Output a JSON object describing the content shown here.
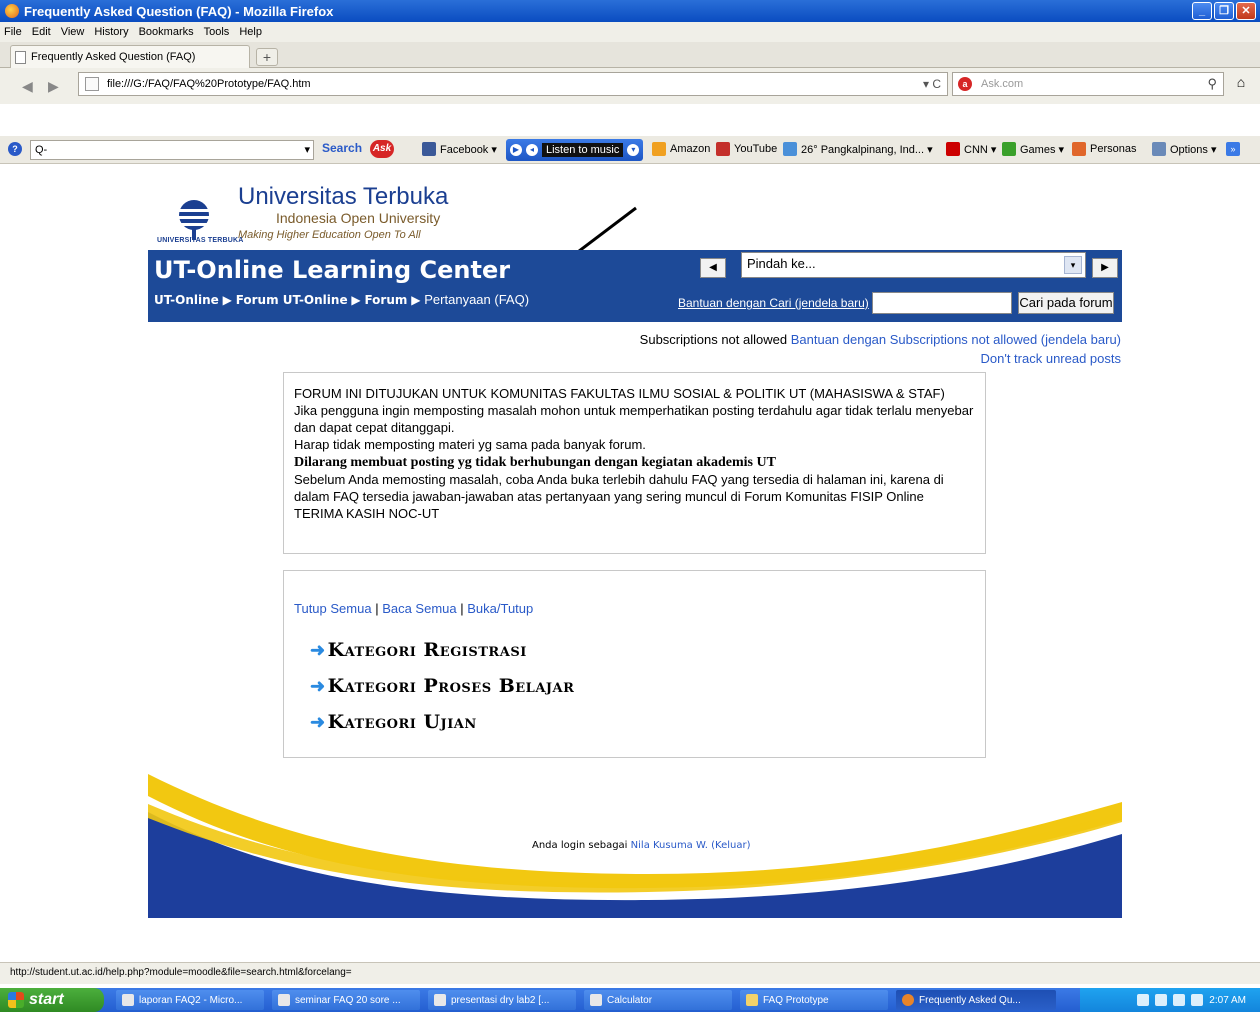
{
  "window": {
    "title": "Frequently Asked Question (FAQ) - Mozilla Firefox",
    "buttons": [
      "_",
      "❐",
      "✕"
    ]
  },
  "menu": [
    "File",
    "Edit",
    "View",
    "History",
    "Bookmarks",
    "Tools",
    "Help"
  ],
  "tab": {
    "label": "Frequently Asked Question (FAQ)",
    "new_tab": "+"
  },
  "nav": {
    "url": "file:///G:/FAQ/FAQ%20Prototype/FAQ.htm",
    "ask_placeholder": "Ask.com"
  },
  "toolbar": {
    "search_placeholder": "Q-",
    "search_label": "Search",
    "ask_logo": "Ask",
    "items": [
      {
        "label": "Facebook ▾",
        "color": "#3b5998"
      },
      {
        "label": "Amazon",
        "color": "#f0a020"
      },
      {
        "label": "YouTube",
        "color": "#c4302b"
      },
      {
        "label": "26° Pangkalpinang, Ind... ▾",
        "color": "#4a90d9"
      },
      {
        "label": "CNN ▾",
        "color": "#cc0000"
      },
      {
        "label": "Games ▾",
        "color": "#3aa02a"
      },
      {
        "label": "Personas",
        "color": "#e0662a"
      },
      {
        "label": "Options ▾",
        "color": "#6a8ab8"
      }
    ],
    "music_label": "Listen to music"
  },
  "site": {
    "uni_name": "Universitas Terbuka",
    "uni_sub": "Indonesia Open University",
    "uni_tag": "Making Higher Education Open To All",
    "logo_caption": "UNIVERSITAS TERBUKA",
    "title": "UT-Online Learning Center",
    "breadcrumb": {
      "b1": "UT-Online",
      "b2": "Forum UT-Online",
      "b3": "Forum",
      "current": "Pertanyaan (FAQ)"
    },
    "jump_placeholder": "Pindah ke...",
    "help_search_link": "Bantuan dengan Cari (jendela baru)",
    "search_button": "Cari pada forum"
  },
  "subscriptions": {
    "status": "Subscriptions not allowed",
    "help_link": "Bantuan dengan Subscriptions not allowed (jendela baru)",
    "track_link": "Don't track unread posts"
  },
  "intro": {
    "line1": "FORUM INI DITUJUKAN UNTUK KOMUNITAS FAKULTAS ILMU SOSIAL & POLITIK UT (MAHASISWA & STAF)",
    "line2": "Jika pengguna ingin memposting masalah mohon untuk memperhatikan posting terdahulu agar tidak terlalu menyebar dan dapat cepat ditanggapi.",
    "line3": "Harap tidak memposting materi yg sama pada banyak forum.",
    "bold": "Dilarang membuat posting yg tidak berhubungan dengan kegiatan akademis UT",
    "line4": "Sebelum Anda memosting masalah, coba Anda buka terlebih dahulu FAQ yang tersedia di halaman ini, karena di dalam FAQ tersedia jawaban-jawaban atas pertanyaan yang sering muncul di Forum Komunitas FISIP Online TERIMA KASIH NOC-UT"
  },
  "faq": {
    "collapse_all": "Tutup Semua",
    "read_all": "Baca Semua",
    "toggle": "Buka/Tutup",
    "categories": [
      "Kategori Registrasi",
      "Kategori Proses Belajar",
      "Kategori Ujian"
    ]
  },
  "footer": {
    "login_prefix": "Anda login sebagai",
    "user": "Nila Kusuma W.",
    "logout": "(Keluar)"
  },
  "status_url": "http://student.ut.ac.id/help.php?module=moodle&file=search.html&forcelang=",
  "taskbar": {
    "start": "start",
    "tasks": [
      "laporan FAQ2 - Micro...",
      "seminar FAQ 20 sore ...",
      "presentasi dry lab2 [...",
      "Calculator",
      "FAQ Prototype",
      "Frequently Asked Qu..."
    ],
    "clock": "2:07 AM"
  },
  "colors": {
    "header_blue": "#1d4a98",
    "link_blue": "#2a5ac8",
    "footer_yellow": "#f2c811"
  }
}
